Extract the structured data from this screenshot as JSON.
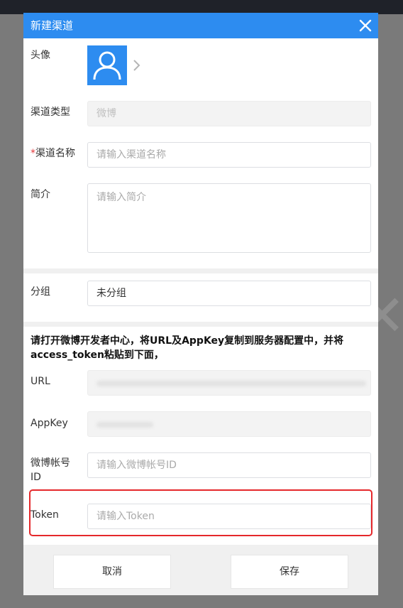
{
  "dialog": {
    "title": "新建渠道"
  },
  "form": {
    "avatar": {
      "label": "头像"
    },
    "channel_type": {
      "label": "渠道类型",
      "value": "微博"
    },
    "channel_name": {
      "required_mark": "*",
      "label": "渠道名称",
      "placeholder": "请输入渠道名称"
    },
    "intro": {
      "label": "简介",
      "placeholder": "请输入简介"
    },
    "group": {
      "label": "分组",
      "value": "未分组"
    },
    "notice": "请打开微博开发者中心，将URL及AppKey复制到服务器配置中，并将access_token粘贴到下面，",
    "url": {
      "label": "URL"
    },
    "appkey": {
      "label": "AppKey"
    },
    "weibo_account_id": {
      "label": "微博帐号ID",
      "placeholder": "请输入微博帐号ID"
    },
    "token": {
      "label": "Token",
      "placeholder": "请输入Token"
    }
  },
  "footer": {
    "cancel_label": "取消",
    "save_label": "保存"
  },
  "colors": {
    "header": "#2d8cf0",
    "highlight": "#e5282b",
    "required": "#e4393c"
  },
  "icons": [
    "close-icon",
    "user-avatar-icon",
    "chevron-right-icon"
  ]
}
